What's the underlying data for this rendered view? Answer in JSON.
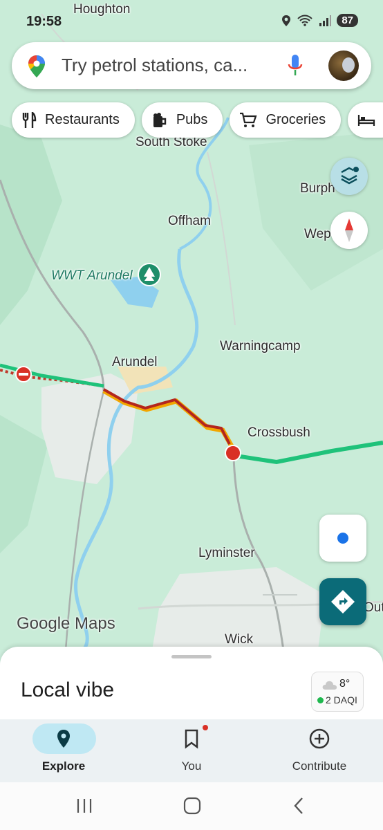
{
  "status_bar": {
    "time": "19:58",
    "battery": "87",
    "icons": [
      "location-icon",
      "wifi-icon",
      "signal-icon"
    ]
  },
  "search": {
    "placeholder": "Try petrol stations, ca..."
  },
  "chips": [
    {
      "label": "Restaurants",
      "icon": "cutlery-icon"
    },
    {
      "label": "Pubs",
      "icon": "beer-mug-icon"
    },
    {
      "label": "Groceries",
      "icon": "cart-icon"
    },
    {
      "label": "",
      "icon": "bed-icon"
    }
  ],
  "map": {
    "places": [
      {
        "name": "Houghton",
        "style": "normal"
      },
      {
        "name": "South Stoke",
        "style": "normal"
      },
      {
        "name": "Burph",
        "style": "normal"
      },
      {
        "name": "Offham",
        "style": "normal"
      },
      {
        "name": "Wep",
        "style": "normal"
      },
      {
        "name": "WWT Arundel",
        "style": "italic"
      },
      {
        "name": "Warningcamp",
        "style": "normal"
      },
      {
        "name": "Arundel",
        "style": "normal"
      },
      {
        "name": "Crossbush",
        "style": "normal"
      },
      {
        "name": "Lyminster",
        "style": "normal"
      },
      {
        "name": "Wick",
        "style": "normal"
      },
      {
        "name": "Out",
        "style": "normal"
      }
    ],
    "logo": "Google Maps",
    "colors": {
      "traffic_green": "#1fc27a",
      "traffic_red": "#b3261e",
      "traffic_yellow": "#f2a600",
      "river": "#8fd0ee"
    }
  },
  "sheet": {
    "title": "Local vibe",
    "weather": {
      "temp": "8°",
      "aqi": "2 DAQI"
    }
  },
  "nav": {
    "items": [
      {
        "label": "Explore",
        "icon": "location-pin-icon",
        "active": true
      },
      {
        "label": "You",
        "icon": "bookmark-icon",
        "active": false
      },
      {
        "label": "Contribute",
        "icon": "add-circle-icon",
        "active": false
      }
    ]
  }
}
